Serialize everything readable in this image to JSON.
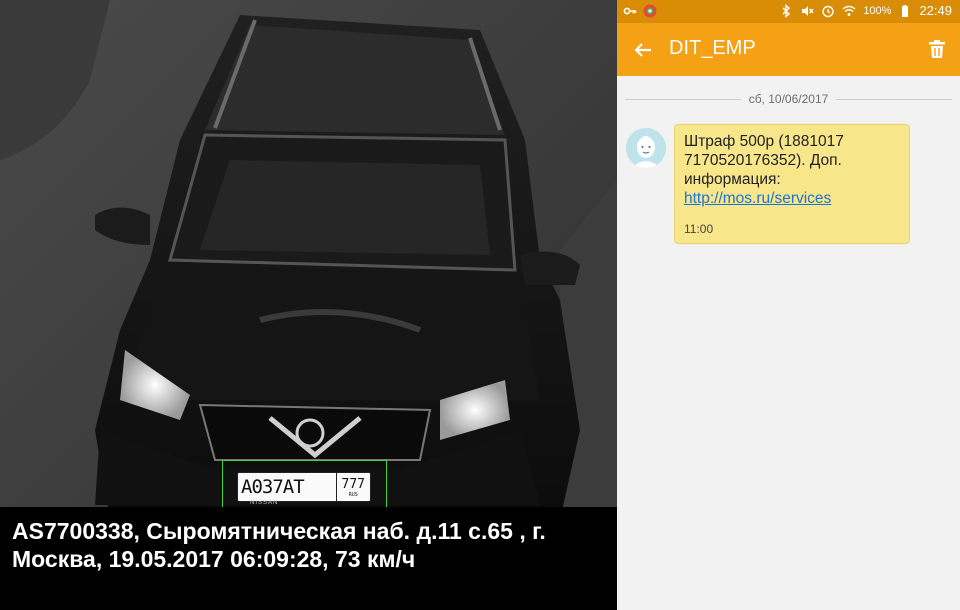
{
  "camera": {
    "plate_main": "А037АТ",
    "plate_region": "777",
    "plate_region_sub": "RUS",
    "plate_brand": "NISSAN",
    "caption": "AS7700338, Сыромятническая наб. д.11 с.65 , г. Москва, 19.05.2017 06:09:28, 73 км/ч"
  },
  "statusbar": {
    "left_icons": [
      "key-icon",
      "app-icon"
    ],
    "right_icons": [
      "bluetooth-icon",
      "mute-icon",
      "alarm-icon",
      "wifi-icon"
    ],
    "battery_percent": "100%",
    "time": "22:49"
  },
  "appbar": {
    "title": "DIT_EMP",
    "back_icon": "arrow-back-icon",
    "delete_icon": "trash-icon"
  },
  "conversation": {
    "date": "сб, 10/06/2017",
    "message": {
      "text_before_link": "Штраф 500р (1881017 7170520176352). Доп. информация: ",
      "link": "http://mos.ru/services",
      "time": "11:00"
    }
  },
  "colors": {
    "statusbar": "#d98c06",
    "appbar": "#f4a115",
    "bubble": "#f8e68a",
    "link": "#1a73d9"
  }
}
